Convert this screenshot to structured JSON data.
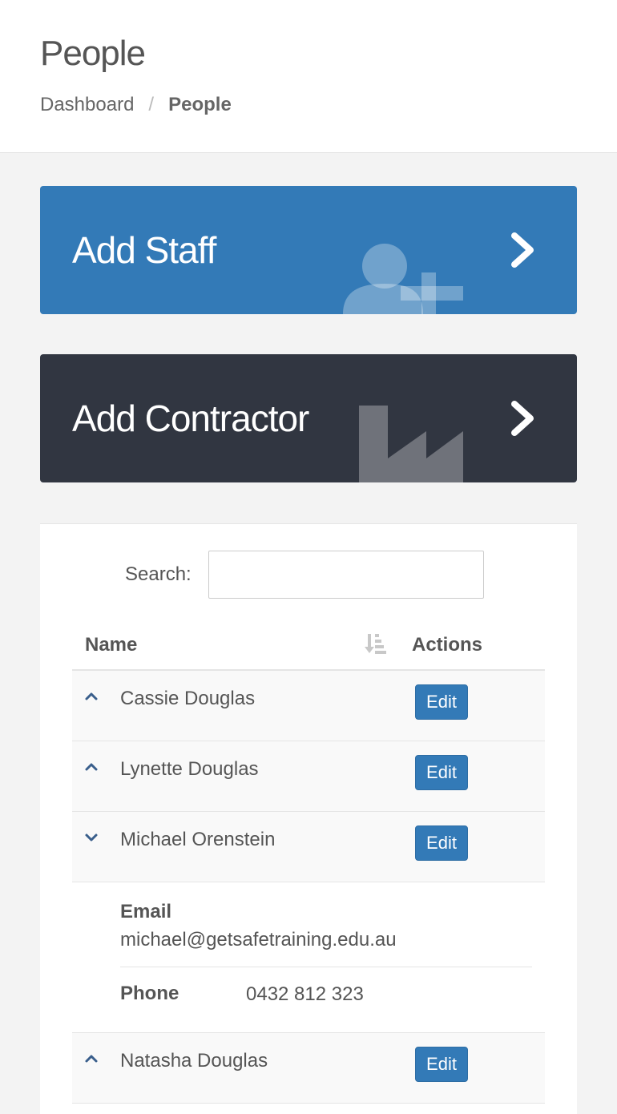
{
  "header": {
    "title": "People",
    "breadcrumb": {
      "home": "Dashboard",
      "separator": "/",
      "current": "People"
    }
  },
  "tiles": {
    "staff": {
      "label": "Add Staff",
      "icon": "add-user-icon",
      "color": "#337ab7"
    },
    "contractor": {
      "label": "Add Contractor",
      "icon": "factory-icon",
      "color": "#313641"
    }
  },
  "search": {
    "label": "Search:",
    "value": ""
  },
  "table": {
    "columns": {
      "name": "Name",
      "actions": "Actions"
    },
    "edit_label": "Edit",
    "rows": [
      {
        "name": "Cassie Douglas",
        "expanded": false
      },
      {
        "name": "Lynette Douglas",
        "expanded": false
      },
      {
        "name": "Michael Orenstein",
        "expanded": true
      },
      {
        "name": "Natasha Douglas",
        "expanded": false
      }
    ],
    "detail": {
      "email_label": "Email",
      "email": "michael@getsafetraining.edu.au",
      "phone_label": "Phone",
      "phone": "0432 812 323"
    }
  },
  "colors": {
    "primary": "#337ab7",
    "dark": "#313641",
    "background": "#f3f3f3"
  }
}
